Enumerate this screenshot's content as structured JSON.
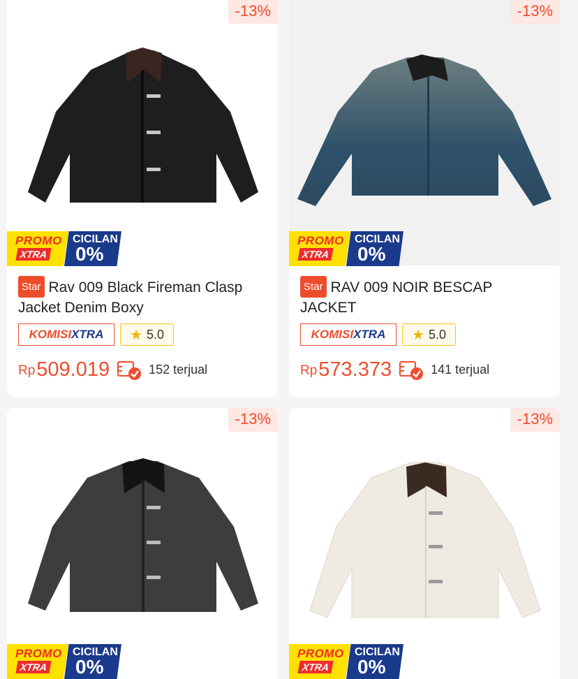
{
  "products": [
    {
      "discount": "-13%",
      "promo": {
        "top": "PROMO",
        "sub": "XTRA"
      },
      "cicilan": {
        "label": "CICILAN",
        "value": "0%"
      },
      "badge": "Star",
      "title": "Rav 009 Black Fireman Clasp Jacket Denim Boxy",
      "komisi": {
        "a": "KOMISI",
        "b": "XTRA"
      },
      "rating": "5.0",
      "currency": "Rp",
      "price": "509.019",
      "sold": "152 terjual",
      "jacket_color": "#1e1e1e",
      "collar_color": "#3a2620"
    },
    {
      "discount": "-13%",
      "promo": {
        "top": "PROMO",
        "sub": "XTRA"
      },
      "cicilan": {
        "label": "CICILAN",
        "value": "0%"
      },
      "badge": "Star",
      "title": "RAV 009 NOIR BESCAP JACKET",
      "komisi": {
        "a": "KOMISI",
        "b": "XTRA"
      },
      "rating": "5.0",
      "currency": "Rp",
      "price": "573.373",
      "sold": "141 terjual",
      "jacket_color": "#3f5b6b",
      "collar_color": "#1c1c1c"
    },
    {
      "discount": "-13%",
      "promo": {
        "top": "PROMO",
        "sub": "XTRA"
      },
      "cicilan": {
        "label": "CICILAN",
        "value": "0%"
      },
      "jacket_color": "#3d3d3f",
      "collar_color": "#141414"
    },
    {
      "discount": "-13%",
      "promo": {
        "top": "PROMO",
        "sub": "XTRA"
      },
      "cicilan": {
        "label": "CICILAN",
        "value": "0%"
      },
      "jacket_color": "#efebe3",
      "collar_color": "#3b2a22"
    }
  ]
}
